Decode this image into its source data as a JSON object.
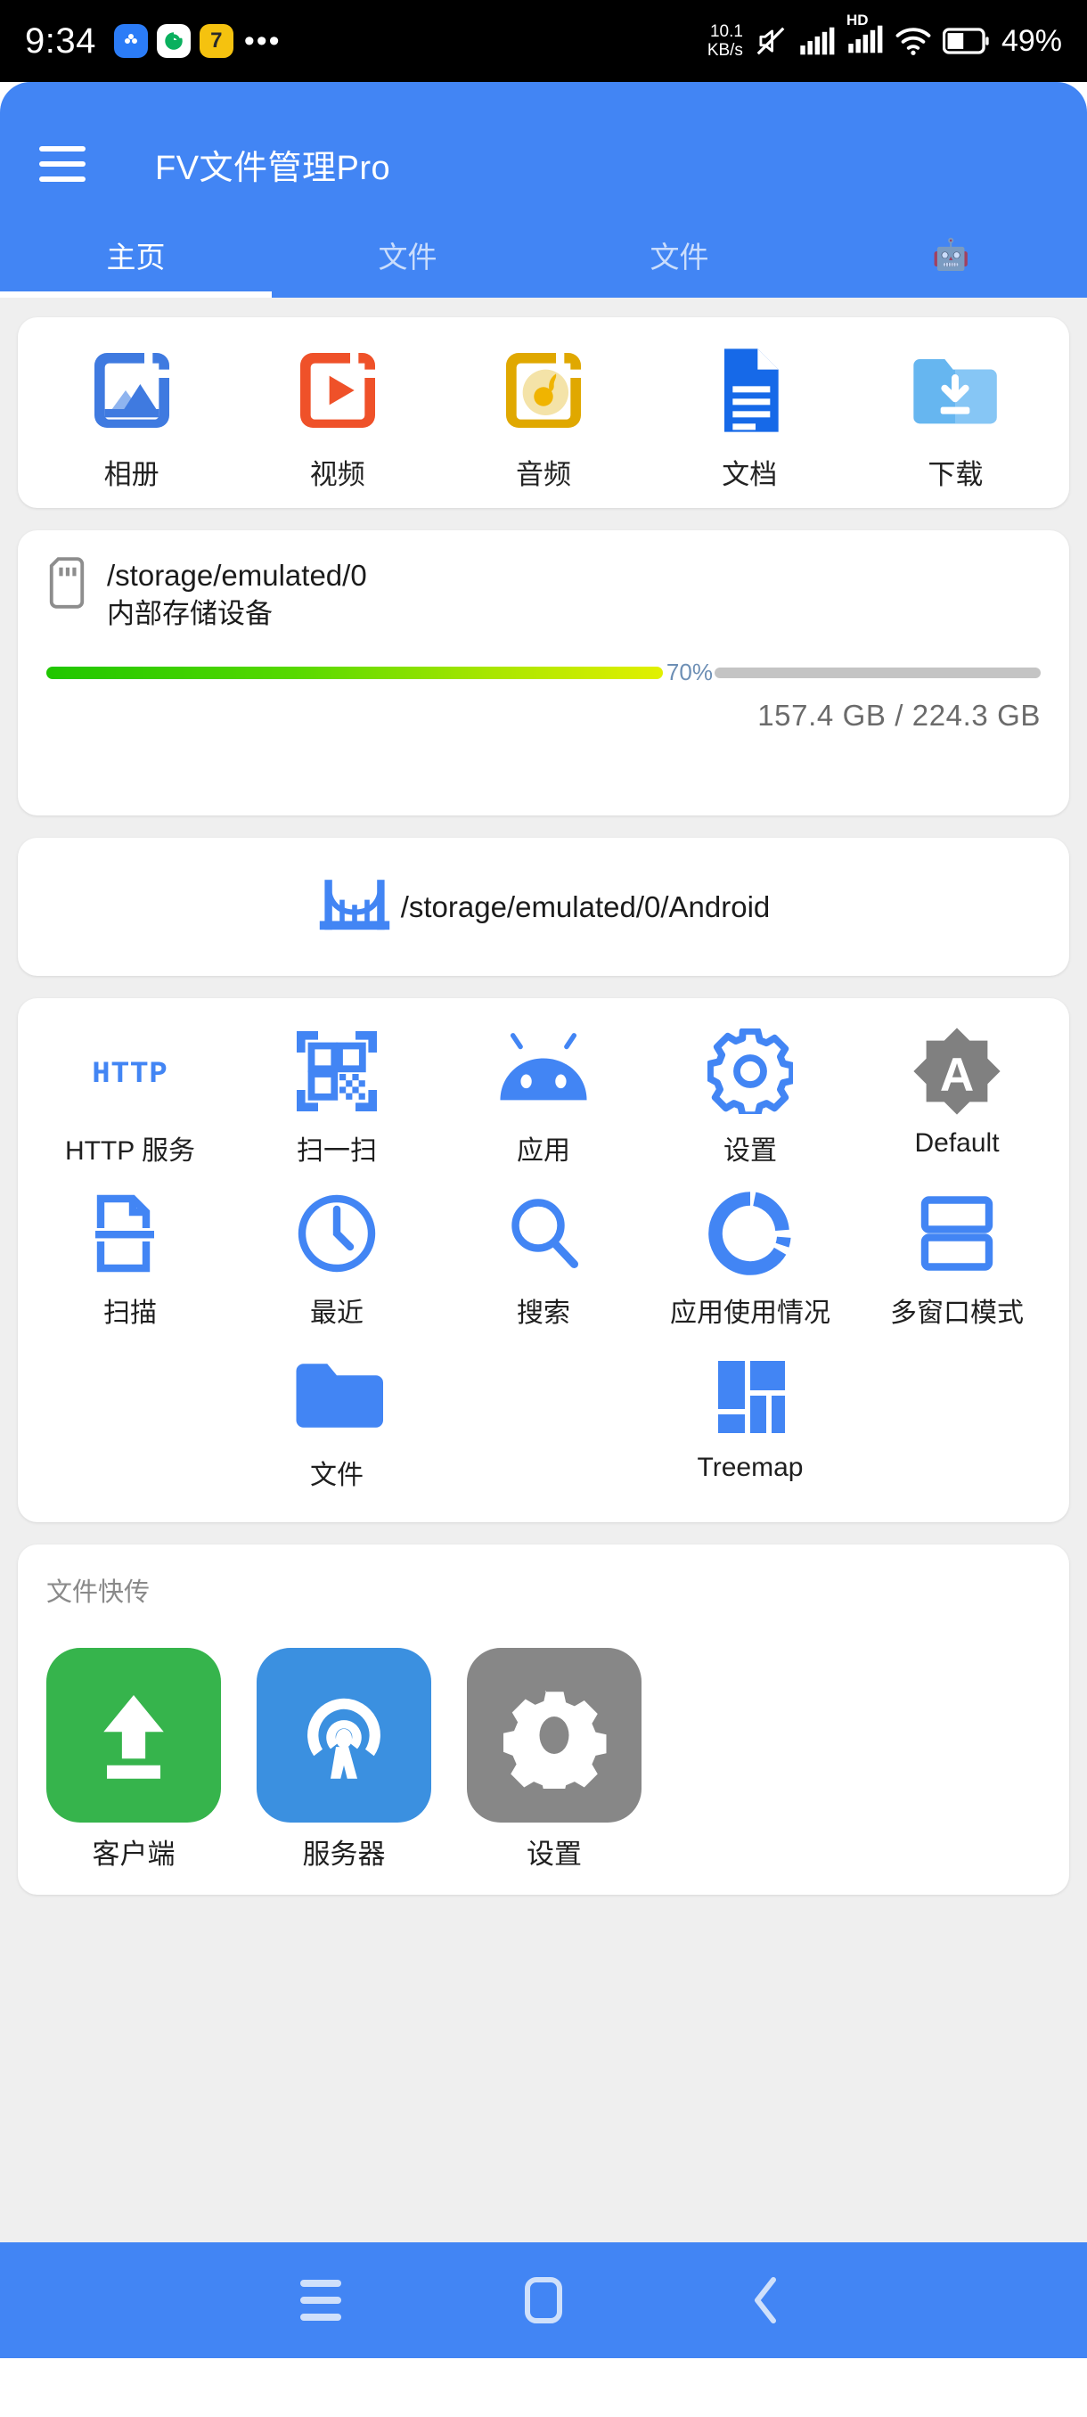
{
  "statusbar": {
    "time": "9:34",
    "app_badges": [
      "cloud-icon",
      "recycle-icon",
      "7-icon"
    ],
    "overflow": "•••",
    "net_speed_value": "10.1",
    "net_speed_unit": "KB/s",
    "hd_label": "HD",
    "battery_text": "49%",
    "icons": [
      "mute-icon",
      "signal-icon",
      "signal-hd-icon",
      "wifi-icon",
      "battery-icon"
    ]
  },
  "appbar": {
    "menu_icon": "hamburger-icon",
    "title": "FV文件管理Pro",
    "tabs": [
      {
        "label": "主页",
        "active": true
      },
      {
        "label": "文件",
        "active": false
      },
      {
        "label": "文件",
        "active": false
      },
      {
        "label": "🤖",
        "active": false
      }
    ]
  },
  "media": {
    "items": [
      {
        "label": "相册",
        "icon": "photos-icon",
        "color": "#3f7ae0"
      },
      {
        "label": "视频",
        "icon": "video-icon",
        "color": "#ef5129"
      },
      {
        "label": "音频",
        "icon": "audio-icon",
        "color": "#e0a800"
      },
      {
        "label": "文档",
        "icon": "document-icon",
        "color": "#1669e8"
      },
      {
        "label": "下载",
        "icon": "download-folder-icon",
        "color": "#66b6f0"
      }
    ]
  },
  "storage": {
    "icon": "sd-card-icon",
    "path": "/storage/emulated/0",
    "subtitle": "内部存储设备",
    "percent_label": "70%",
    "percent_value": 70,
    "used": "157.4 GB",
    "separator": "/",
    "total": "224.3 GB",
    "size_text": "157.4 GB  /  224.3 GB"
  },
  "android_path": {
    "icon": "bridge-icon",
    "path": "/storage/emulated/0/Android"
  },
  "tools": {
    "rows": [
      [
        {
          "label": "HTTP 服务",
          "icon": "http-icon"
        },
        {
          "label": "扫一扫",
          "icon": "qr-scan-icon"
        },
        {
          "label": "应用",
          "icon": "android-robot-icon"
        },
        {
          "label": "设置",
          "icon": "gear-icon"
        },
        {
          "label": "Default",
          "icon": "default-star-a-icon"
        }
      ],
      [
        {
          "label": "扫描",
          "icon": "scanner-icon"
        },
        {
          "label": "最近",
          "icon": "clock-icon"
        },
        {
          "label": "搜索",
          "icon": "search-icon"
        },
        {
          "label": "应用使用情况",
          "icon": "donut-chart-icon"
        },
        {
          "label": "多窗口模式",
          "icon": "split-screen-icon"
        }
      ],
      [
        {
          "label": "",
          "icon": ""
        },
        {
          "label": "文件",
          "icon": "folder-icon"
        },
        {
          "label": "",
          "icon": ""
        },
        {
          "label": "Treemap",
          "icon": "treemap-icon"
        },
        {
          "label": "",
          "icon": ""
        }
      ]
    ]
  },
  "transfer": {
    "title": "文件快传",
    "items": [
      {
        "label": "客户端",
        "icon": "upload-arrow-icon",
        "color": "#36b44c"
      },
      {
        "label": "服务器",
        "icon": "broadcast-icon",
        "color": "#3b90e0"
      },
      {
        "label": "设置",
        "icon": "gear-icon",
        "color": "#878787"
      }
    ]
  },
  "navbar": {
    "items": [
      {
        "name": "recents-button",
        "icon": "menu-lines-icon"
      },
      {
        "name": "home-button",
        "icon": "home-square-icon"
      },
      {
        "name": "back-button",
        "icon": "chevron-left-icon"
      }
    ]
  },
  "theme": {
    "primary": "#4285f4",
    "page_bg": "#efefef",
    "card_bg": "#ffffff"
  }
}
